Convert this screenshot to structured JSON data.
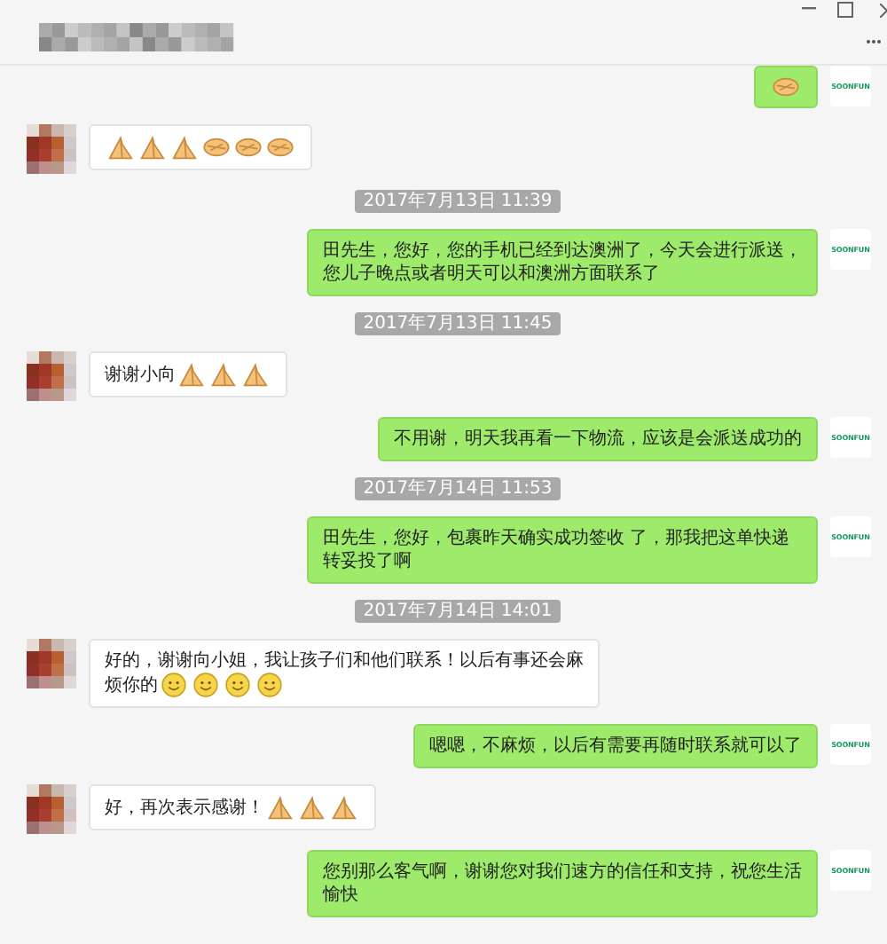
{
  "items": [
    {
      "kind": "outgoing",
      "avatar_text": "SOONFUN",
      "parts": [
        {
          "kind": "shake"
        }
      ]
    },
    {
      "kind": "incoming",
      "parts": [
        {
          "kind": "fold"
        },
        {
          "kind": "fold"
        },
        {
          "kind": "fold"
        },
        {
          "kind": "shake"
        },
        {
          "kind": "shake"
        },
        {
          "kind": "shake"
        }
      ]
    },
    {
      "kind": "time",
      "text": "2017年7月13日 11:39"
    },
    {
      "kind": "outgoing",
      "avatar_text": "SOONFUN",
      "parts": [
        {
          "kind": "text",
          "text": "田先生，您好，您的手机已经到达澳洲了，今天会进行派送，您儿子晚点或者明天可以和澳洲方面联系了"
        }
      ]
    },
    {
      "kind": "time",
      "text": "2017年7月13日 11:45"
    },
    {
      "kind": "incoming",
      "parts": [
        {
          "kind": "text",
          "text": "谢谢小向"
        },
        {
          "kind": "fold"
        },
        {
          "kind": "fold"
        },
        {
          "kind": "fold"
        }
      ]
    },
    {
      "kind": "outgoing",
      "avatar_text": "SOONFUN",
      "parts": [
        {
          "kind": "text",
          "text": "不用谢，明天我再看一下物流，应该是会派送成功的"
        }
      ]
    },
    {
      "kind": "time",
      "text": "2017年7月14日 11:53"
    },
    {
      "kind": "outgoing",
      "avatar_text": "SOONFUN",
      "parts": [
        {
          "kind": "text",
          "text": "田先生，您好，包裹昨天确实成功签收 了，那我把这单快递转妥投了啊"
        }
      ]
    },
    {
      "kind": "time",
      "text": "2017年7月14日 14:01"
    },
    {
      "kind": "incoming",
      "parts": [
        {
          "kind": "text",
          "text": "好的，谢谢向小姐，我让孩子们和他们联系！以后有事还会麻"
        },
        {
          "kind": "text",
          "text": "烦你的"
        },
        {
          "kind": "smile"
        },
        {
          "kind": "smile"
        },
        {
          "kind": "smile"
        },
        {
          "kind": "smile"
        }
      ]
    },
    {
      "kind": "outgoing",
      "avatar_text": "SOONFUN",
      "parts": [
        {
          "kind": "text",
          "text": "嗯嗯，不麻烦，以后有需要再随时联系就可以了"
        }
      ]
    },
    {
      "kind": "incoming",
      "parts": [
        {
          "kind": "text",
          "text": "好，再次表示感谢！"
        },
        {
          "kind": "fold"
        },
        {
          "kind": "fold"
        },
        {
          "kind": "fold"
        }
      ]
    },
    {
      "kind": "outgoing",
      "avatar_text": "SOONFUN",
      "parts": [
        {
          "kind": "text",
          "text": "您别那么客气啊，谢谢您对我们速方的信任和支持，祝您生活愉快"
        }
      ]
    }
  ]
}
